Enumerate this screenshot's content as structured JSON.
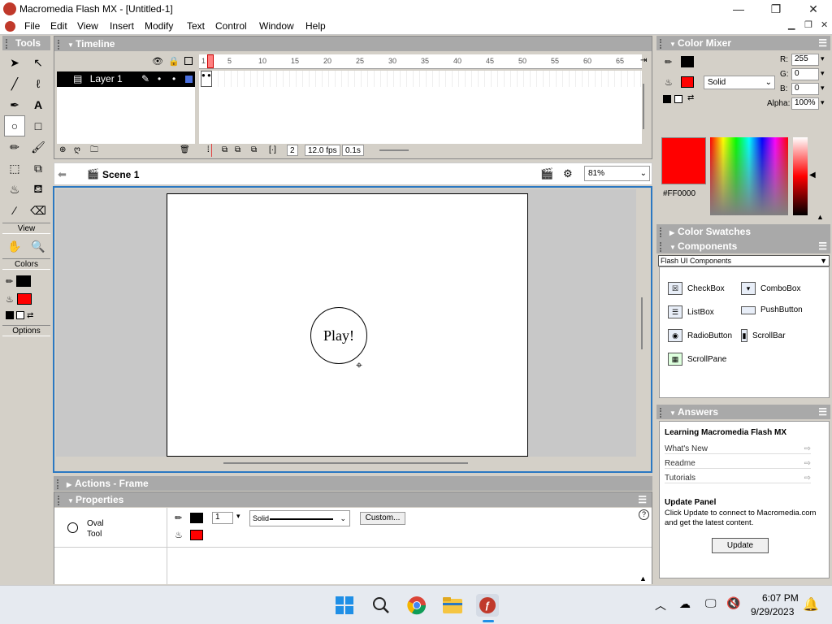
{
  "window": {
    "title": "Macromedia Flash MX - [Untitled-1]",
    "minimize": "—",
    "maximize": "❐",
    "close": "✕"
  },
  "menu": [
    "File",
    "Edit",
    "View",
    "Insert",
    "Modify",
    "Text",
    "Control",
    "Window",
    "Help"
  ],
  "tools": {
    "title": "Tools",
    "view_label": "View",
    "colors_label": "Colors",
    "options_label": "Options"
  },
  "timeline": {
    "title": "Timeline",
    "layer_name": "Layer 1",
    "ruler": [
      "1",
      "5",
      "10",
      "15",
      "20",
      "25",
      "30",
      "35",
      "40",
      "45",
      "50",
      "55",
      "60",
      "65"
    ],
    "frame": "2",
    "fps": "12.0 fps",
    "time": "0.1s"
  },
  "editbar": {
    "scene": "Scene 1",
    "zoom": "81%"
  },
  "stage": {
    "button_text": "Play!"
  },
  "panels": {
    "actions": "Actions - Frame",
    "properties": "Properties"
  },
  "properties": {
    "tool_line1": "Oval",
    "tool_line2": "Tool",
    "stroke_height": "1",
    "stroke_style": "Solid",
    "custom_button": "Custom..."
  },
  "color_mixer": {
    "title": "Color Mixer",
    "fill_type": "Solid",
    "r_label": "R:",
    "r": "255",
    "g_label": "G:",
    "g": "0",
    "b_label": "B:",
    "b": "0",
    "alpha_label": "Alpha:",
    "alpha": "100%",
    "hex": "#FF0000"
  },
  "swatches": {
    "title": "Color Swatches"
  },
  "components": {
    "title": "Components",
    "set": "Flash UI Components",
    "items": [
      "CheckBox",
      "ComboBox",
      "ListBox",
      "PushButton",
      "RadioButton",
      "ScrollBar",
      "ScrollPane"
    ]
  },
  "answers": {
    "title": "Answers",
    "heading": "Learning Macromedia Flash MX",
    "links": [
      "What's New",
      "Readme",
      "Tutorials"
    ],
    "update_heading": "Update Panel",
    "update_text": "Click Update to connect to Macromedia.com and get the latest content.",
    "update_button": "Update"
  },
  "taskbar": {
    "time": "6:07 PM",
    "date": "9/29/2023"
  },
  "colors": {
    "fill": "#FF0000",
    "stroke": "#000000",
    "accent": "#2b78c2"
  }
}
